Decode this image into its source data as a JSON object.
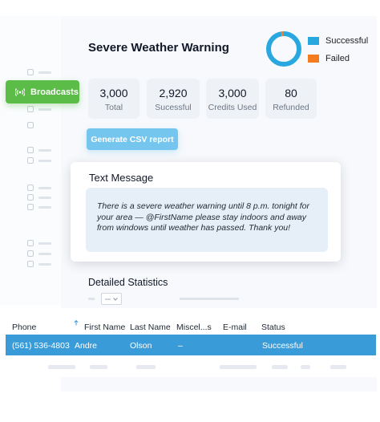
{
  "sidebar": {
    "active_item": {
      "label": "Broadcasts",
      "icon": "broadcast-icon"
    }
  },
  "header": {
    "title": "Severe Weather Warning"
  },
  "chart_data": {
    "type": "pie",
    "categories": [
      "Successful",
      "Failed"
    ],
    "values": [
      2920,
      80
    ],
    "colors": [
      "#29a8e0",
      "#f47c20"
    ]
  },
  "legend": {
    "successful": "Successful",
    "failed": "Failed"
  },
  "stats": [
    {
      "value": "3,000",
      "label": "Total"
    },
    {
      "value": "2,920",
      "label": "Sucessful"
    },
    {
      "value": "3,000",
      "label": "Credits Used"
    },
    {
      "value": "80",
      "label": "Refunded"
    }
  ],
  "csv_button": "Generate CSV report",
  "message": {
    "title": "Text Message",
    "body": "There is a severe weather warning until 8 p.m. tonight for your area — @FirstName please stay indoors and away from windows until weather has passed. Thank you!"
  },
  "detail": {
    "title": "Detailed Statistics"
  },
  "table": {
    "columns": [
      "Phone",
      "First Name",
      "Last Name",
      "Miscel...s",
      "E-mail",
      "Status"
    ],
    "rows": [
      {
        "phone": "(561) 536-4803",
        "first": "Andre",
        "last": "Olson",
        "misc": "–",
        "email": "",
        "status": "Successful"
      }
    ]
  },
  "colors": {
    "accent_green": "#5cbc48",
    "accent_blue": "#3a9bd9",
    "button_blue": "#74c6ee"
  }
}
